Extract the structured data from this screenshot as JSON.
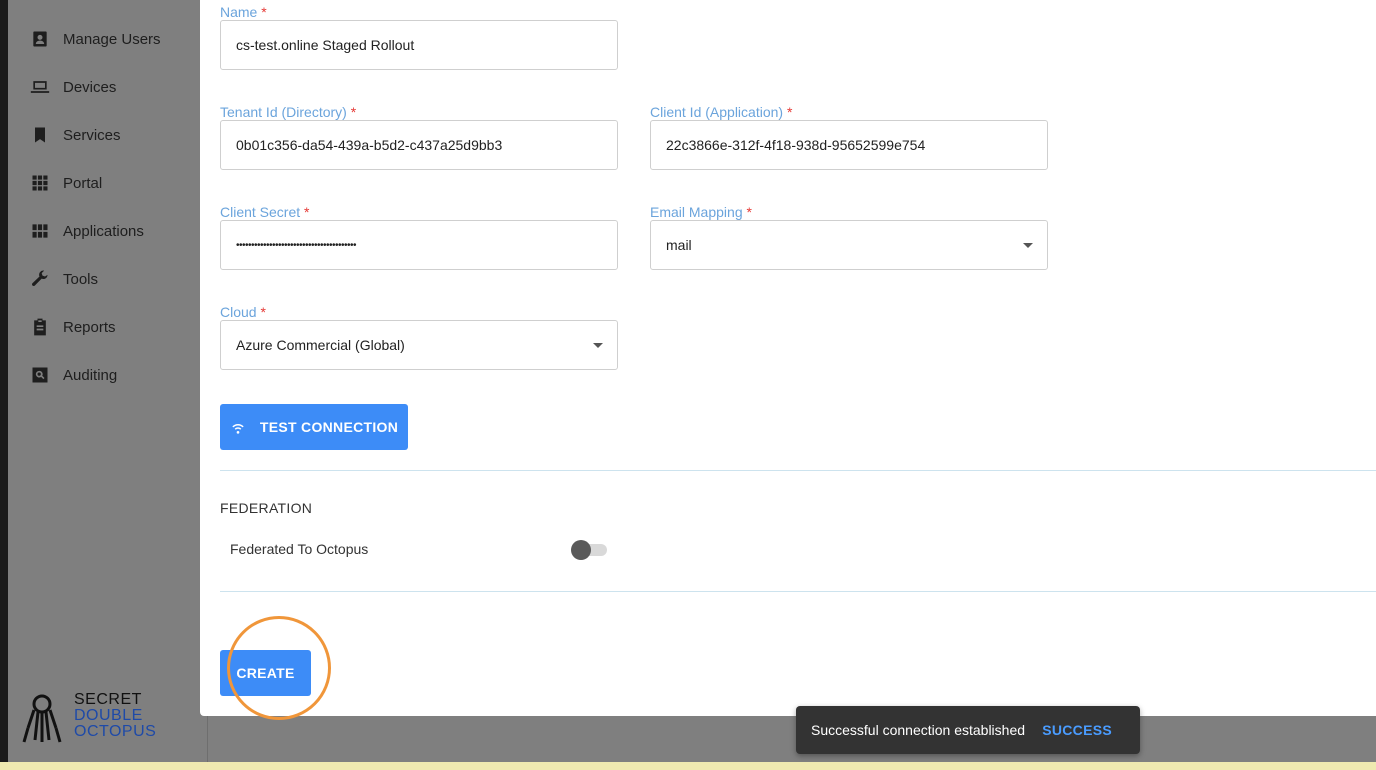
{
  "sidebar": {
    "items": [
      {
        "label": "Manage Users",
        "icon": "badge-icon"
      },
      {
        "label": "Devices",
        "icon": "laptop-icon"
      },
      {
        "label": "Services",
        "icon": "bookmark-icon"
      },
      {
        "label": "Portal",
        "icon": "grid-icon"
      },
      {
        "label": "Applications",
        "icon": "apps-grid-icon"
      },
      {
        "label": "Tools",
        "icon": "wrench-icon"
      },
      {
        "label": "Reports",
        "icon": "clipboard-icon"
      },
      {
        "label": "Auditing",
        "icon": "search-box-icon"
      }
    ],
    "logo": {
      "line1": "SECRET",
      "line2": "DOUBLE",
      "line3": "OCTOPUS"
    }
  },
  "form": {
    "name": {
      "label": "Name",
      "required": "*",
      "value": "cs-test.online Staged Rollout"
    },
    "tenant_id": {
      "label": "Tenant Id (Directory)",
      "required": "*",
      "value": "0b01c356-da54-439a-b5d2-c437a25d9bb3"
    },
    "client_id": {
      "label": "Client Id (Application)",
      "required": "*",
      "value": "22c3866e-312f-4f18-938d-95652599e754"
    },
    "client_secret": {
      "label": "Client Secret",
      "required": "*",
      "value": "••••••••••••••••••••••••••••••••••••••••"
    },
    "email_mapping": {
      "label": "Email Mapping",
      "required": "*",
      "value": "mail"
    },
    "cloud": {
      "label": "Cloud",
      "required": "*",
      "value": "Azure Commercial (Global)"
    },
    "test_connection_label": "TEST CONNECTION",
    "federation": {
      "section_title": "FEDERATION",
      "toggle_label": "Federated To Octopus",
      "enabled": false
    },
    "create_label": "CREATE"
  },
  "snackbar": {
    "message": "Successful connection established",
    "action": "SUCCESS"
  },
  "colors": {
    "accent": "#3d8cf7",
    "label": "#6ba4dc",
    "required": "#e53935",
    "highlight": "#f0963a"
  }
}
